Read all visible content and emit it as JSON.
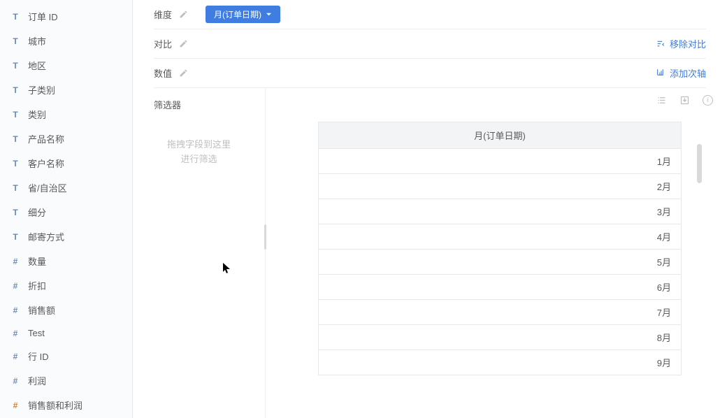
{
  "sidebar": {
    "fields": [
      {
        "icon": "T",
        "label": "订单 ID",
        "type": "text"
      },
      {
        "icon": "T",
        "label": "城市",
        "type": "text"
      },
      {
        "icon": "T",
        "label": "地区",
        "type": "text"
      },
      {
        "icon": "T",
        "label": "子类别",
        "type": "text"
      },
      {
        "icon": "T",
        "label": "类别",
        "type": "text"
      },
      {
        "icon": "T",
        "label": "产品名称",
        "type": "text"
      },
      {
        "icon": "T",
        "label": "客户名称",
        "type": "text"
      },
      {
        "icon": "T",
        "label": "省/自治区",
        "type": "text"
      },
      {
        "icon": "T",
        "label": "细分",
        "type": "text"
      },
      {
        "icon": "T",
        "label": "邮寄方式",
        "type": "text"
      },
      {
        "icon": "#",
        "label": "数量",
        "type": "number"
      },
      {
        "icon": "#",
        "label": "折扣",
        "type": "number"
      },
      {
        "icon": "#",
        "label": "销售额",
        "type": "number"
      },
      {
        "icon": "#",
        "label": "Test",
        "type": "number"
      },
      {
        "icon": "#",
        "label": "行 ID",
        "type": "number"
      },
      {
        "icon": "#",
        "label": "利润",
        "type": "number"
      },
      {
        "icon": "#",
        "label": "销售额和利润",
        "type": "calc"
      }
    ]
  },
  "config": {
    "dimension_label": "维度",
    "dimension_pill": "月(订单日期)",
    "compare_label": "对比",
    "compare_remove": "移除对比",
    "value_label": "数值",
    "value_add_axis": "添加次轴"
  },
  "filter": {
    "title": "筛选器",
    "drop_line1": "拖拽字段到这里",
    "drop_line2": "进行筛选"
  },
  "chart_data": {
    "type": "table",
    "header": "月(订单日期)",
    "rows": [
      "1月",
      "2月",
      "3月",
      "4月",
      "5月",
      "6月",
      "7月",
      "8月",
      "9月"
    ]
  }
}
